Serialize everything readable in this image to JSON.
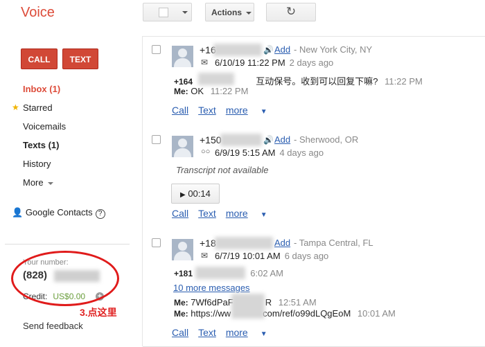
{
  "app": {
    "title": "Voice"
  },
  "toolbar": {
    "actions_label": "Actions",
    "refresh_icon": "↻"
  },
  "sidebar": {
    "call_label": "CALL",
    "text_label": "TEXT",
    "nav": [
      {
        "label": "Inbox (1)"
      },
      {
        "label": "Starred"
      },
      {
        "label": "Voicemails"
      },
      {
        "label": "Texts (1)"
      },
      {
        "label": "History"
      },
      {
        "label": "More"
      }
    ],
    "contacts_label": "Google Contacts",
    "help_glyph": "?",
    "your_number_label": "Your number:",
    "your_number": "(828)",
    "credit_label": "Credit:",
    "credit_value": "US$0.00",
    "add_glyph": "+",
    "feedback_label": "Send feedback",
    "annotation": "3.点这里"
  },
  "messages": [
    {
      "phone": "+16",
      "add_label": "Add",
      "location": "- New York City, NY",
      "date": "6/10/19 11:22 PM",
      "ago": "2 days ago",
      "line1_from": "+164",
      "line1_text": "互动保号。收到可以回复下嘛?",
      "line1_time": "11:22 PM",
      "line2_from": "Me:",
      "line2_text": "OK",
      "line2_time": "11:22 PM",
      "actions": [
        "Call",
        "Text",
        "more"
      ]
    },
    {
      "phone": "+150",
      "add_label": "Add",
      "location": "- Sherwood, OR",
      "date": "6/9/19 5:15 AM",
      "ago": "4 days ago",
      "transcript": "Transcript not available",
      "play_icon": "▶",
      "duration": "00:14",
      "actions": [
        "Call",
        "Text",
        "more"
      ]
    },
    {
      "phone": "+18",
      "add_label": "Add",
      "location": "- Tampa Central, FL",
      "date": "6/7/19 10:01 AM",
      "ago": "6 days ago",
      "line1_from": "+181",
      "line1_time": "6:02 AM",
      "more_messages": "10 more messages",
      "line2_from": "Me:",
      "line2_text": "7Wf6dPaF",
      "line2_tail": "R",
      "line2_time": "12:51 AM",
      "line3_from": "Me:",
      "line3_text": "https://ww",
      "line3_tail": "com/ref/o99dLQgEoM",
      "line3_time": "10:01 AM",
      "actions": [
        "Call",
        "Text",
        "more"
      ]
    }
  ]
}
